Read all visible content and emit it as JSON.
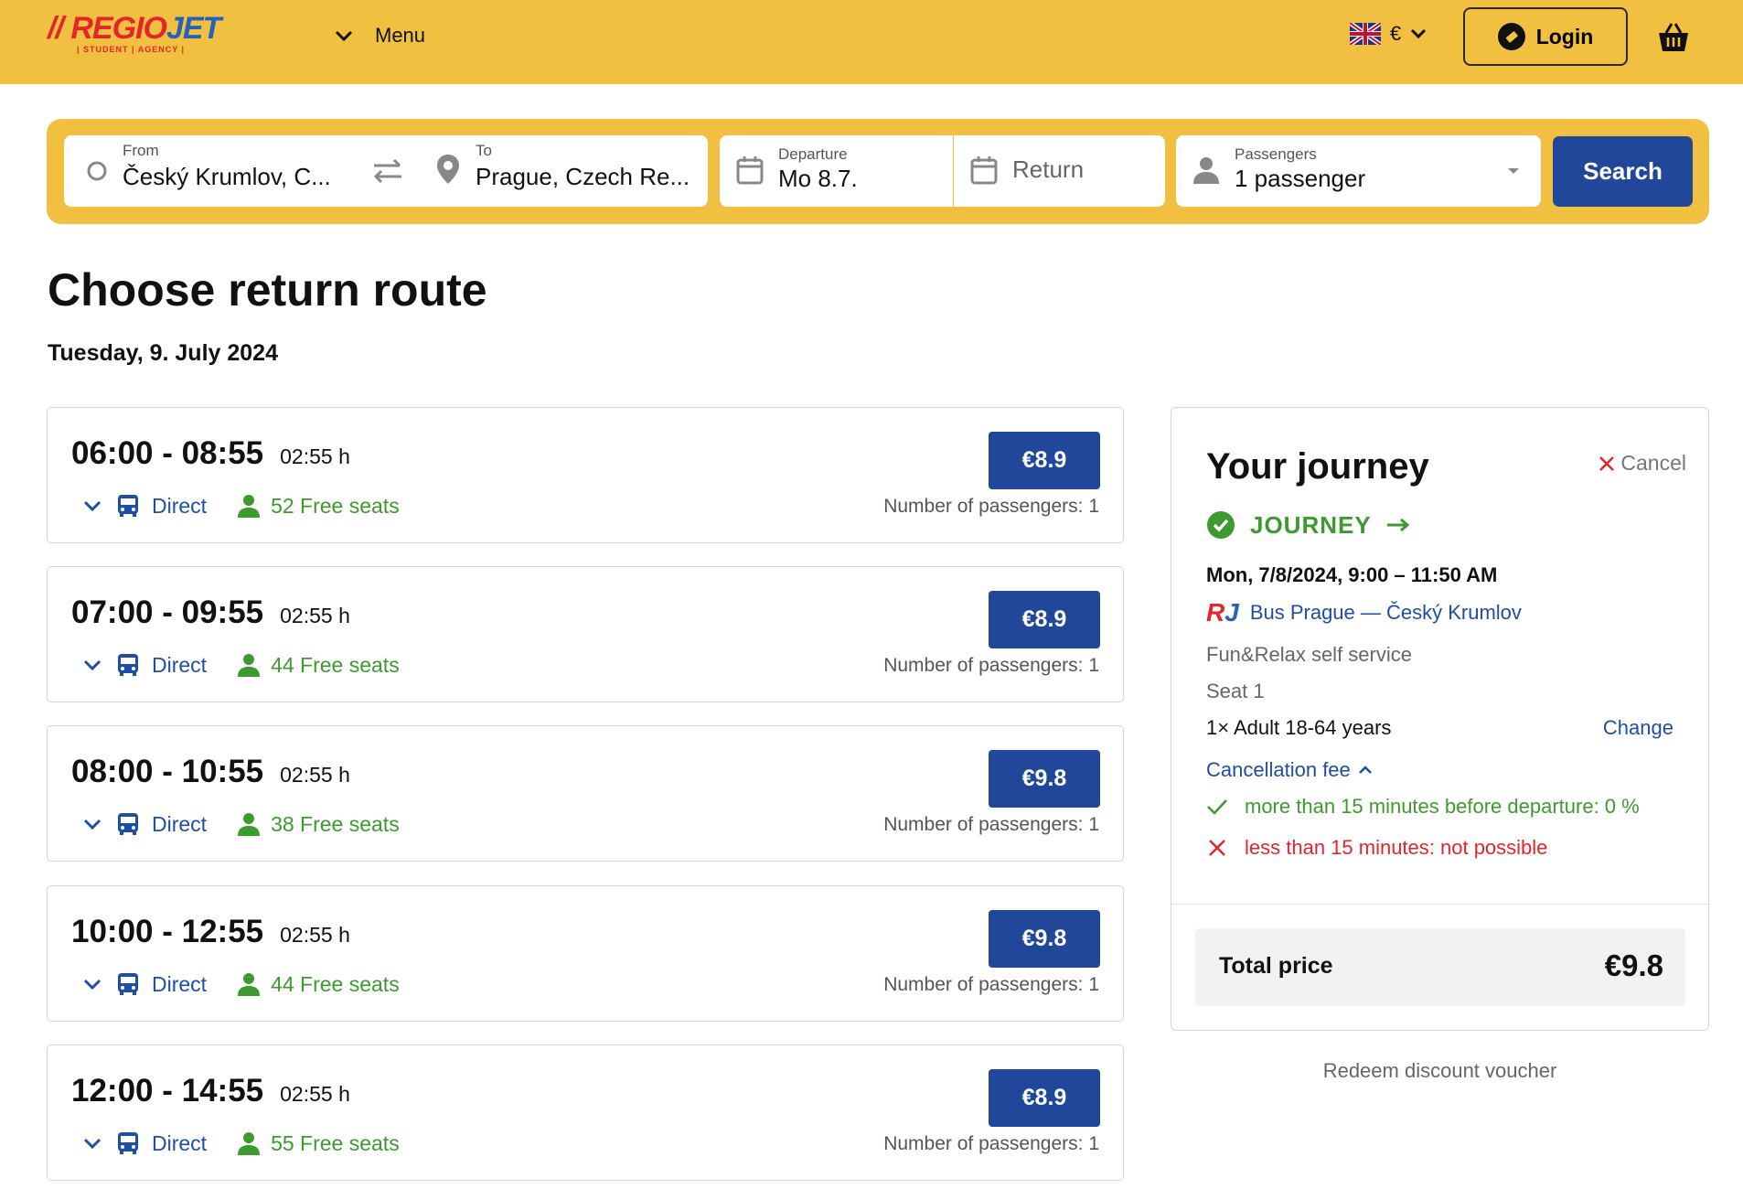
{
  "header": {
    "logo_text_a": "REGIO",
    "logo_text_b": "JET",
    "logo_sub": "| STUDENT | AGENCY |",
    "menu_label": "Menu",
    "currency": "€",
    "login_label": "Login"
  },
  "search": {
    "from_label": "From",
    "from_value": "Český Krumlov, C...",
    "to_label": "To",
    "to_value": "Prague, Czech Re...",
    "departure_label": "Departure",
    "departure_value": "Mo 8.7.",
    "return_label": "Return",
    "passengers_label": "Passengers",
    "passengers_value": "1 passenger",
    "search_button": "Search"
  },
  "page": {
    "title": "Choose return route",
    "date": "Tuesday, 9. July 2024"
  },
  "routes": [
    {
      "time": "06:00 - 08:55",
      "duration": "02:55 h",
      "type": "Direct",
      "seats": "52 Free seats",
      "price": "€8.9",
      "pax": "Number of passengers: 1"
    },
    {
      "time": "07:00 - 09:55",
      "duration": "02:55 h",
      "type": "Direct",
      "seats": "44 Free seats",
      "price": "€8.9",
      "pax": "Number of passengers: 1"
    },
    {
      "time": "08:00 - 10:55",
      "duration": "02:55 h",
      "type": "Direct",
      "seats": "38 Free seats",
      "price": "€9.8",
      "pax": "Number of passengers: 1"
    },
    {
      "time": "10:00 - 12:55",
      "duration": "02:55 h",
      "type": "Direct",
      "seats": "44 Free seats",
      "price": "€9.8",
      "pax": "Number of passengers: 1"
    },
    {
      "time": "12:00 - 14:55",
      "duration": "02:55 h",
      "type": "Direct",
      "seats": "55 Free seats",
      "price": "€8.9",
      "pax": "Number of passengers: 1"
    }
  ],
  "journey": {
    "title": "Your journey",
    "cancel": "Cancel",
    "badge": "JOURNEY",
    "when": "Mon, 7/8/2024, 9:00 – 11:50 AM",
    "rj_a": "R",
    "rj_b": "J",
    "line": "Bus Prague — Český Krumlov",
    "service": "Fun&Relax self service",
    "seat": "Seat 1",
    "adult": "1× Adult 18-64 years",
    "change": "Change",
    "fee_label": "Cancellation fee",
    "rule_ok": "more than 15 minutes before departure: 0 %",
    "rule_no": "less than 15 minutes: not possible",
    "total_label": "Total price",
    "total_value": "€9.8"
  },
  "voucher": "Redeem discount voucher",
  "colors": {
    "brand_yellow": "#f2c041",
    "brand_blue": "#21479a",
    "link_blue": "#1f4ea6",
    "green": "#3d9a2e",
    "red": "#e2262b"
  }
}
